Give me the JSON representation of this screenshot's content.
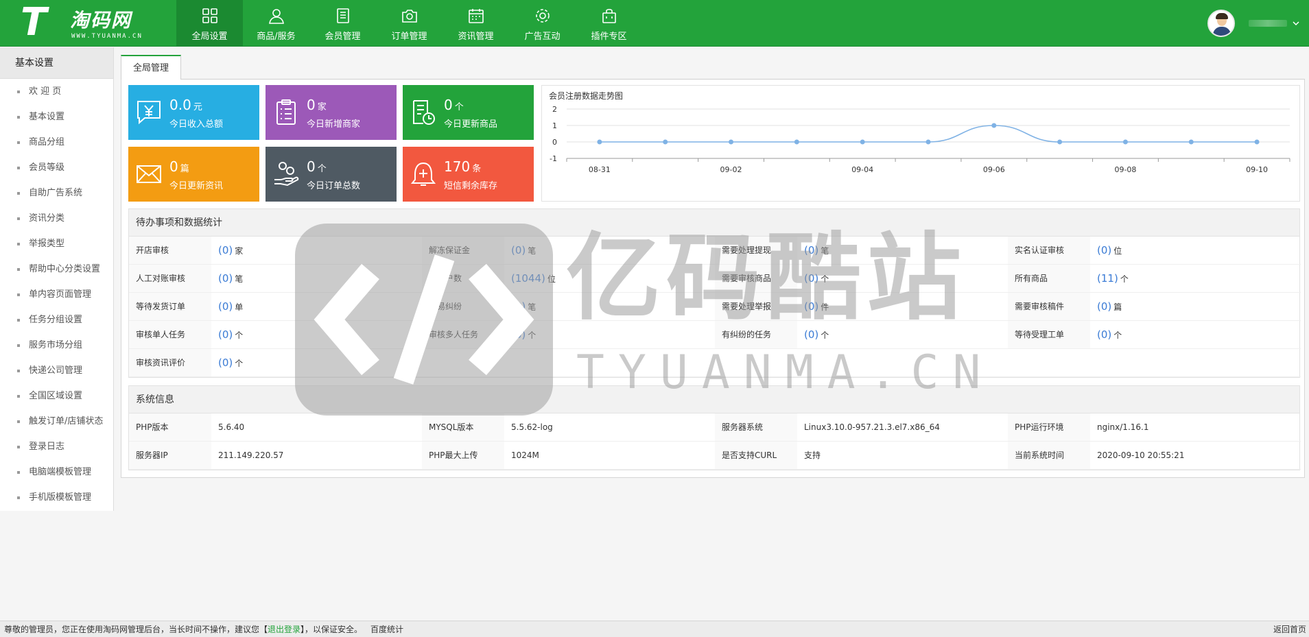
{
  "brand": {
    "name": "淘码网",
    "sub": "WWW.TYUANMA.CN",
    "mark": "T"
  },
  "nav": [
    {
      "label": "全局设置",
      "icon": "grid-icon",
      "active": true
    },
    {
      "label": "商品/服务",
      "icon": "user-icon"
    },
    {
      "label": "会员管理",
      "icon": "document-icon"
    },
    {
      "label": "订单管理",
      "icon": "camera-icon"
    },
    {
      "label": "资讯管理",
      "icon": "calendar-icon"
    },
    {
      "label": "广告互动",
      "icon": "gear-icon"
    },
    {
      "label": "插件专区",
      "icon": "bag-icon"
    }
  ],
  "sidebar": {
    "title": "基本设置",
    "items": [
      "欢 迎 页",
      "基本设置",
      "商品分组",
      "会员等级",
      "自助广告系统",
      "资讯分类",
      "举报类型",
      "帮助中心分类设置",
      "单内容页面管理",
      "任务分组设置",
      "服务市场分组",
      "快递公司管理",
      "全国区域设置",
      "触发订单/店铺状态",
      "登录日志",
      "电脑端模板管理",
      "手机版模板管理"
    ]
  },
  "tab": {
    "label": "全局管理"
  },
  "cards": [
    {
      "value": "0.0",
      "unit": "元",
      "label": "今日收入总额",
      "color": "#27aee2",
      "icon": "money-chat-icon"
    },
    {
      "value": "0",
      "unit": "家",
      "label": "今日新增商家",
      "color": "#9c59b8",
      "icon": "clipboard-icon"
    },
    {
      "value": "0",
      "unit": "个",
      "label": "今日更新商品",
      "color": "#23a33b",
      "icon": "doc-clock-icon"
    },
    {
      "value": "0",
      "unit": "篇",
      "label": "今日更新资讯",
      "color": "#f39c12",
      "icon": "mail-icon"
    },
    {
      "value": "0",
      "unit": "个",
      "label": "今日订单总数",
      "color": "#4f5a63",
      "icon": "hand-coins-icon"
    },
    {
      "value": "170",
      "unit": "条",
      "label": "短信剩余库存",
      "color": "#f2583f",
      "icon": "bell-icon"
    }
  ],
  "chart_data": {
    "type": "line",
    "title": "会员注册数据走势图",
    "x": [
      "08-31",
      "09-01",
      "09-02",
      "09-03",
      "09-04",
      "09-05",
      "09-06",
      "09-07",
      "09-08",
      "09-09",
      "09-10"
    ],
    "xticks": [
      "08-31",
      "09-02",
      "09-04",
      "09-06",
      "09-08",
      "09-10"
    ],
    "values": [
      0,
      0,
      0,
      0,
      0,
      0,
      1,
      0,
      0,
      0,
      0
    ],
    "ylim": [
      -1,
      2
    ],
    "yticks": [
      "2",
      "1",
      "0",
      "-1"
    ],
    "grid": true,
    "color": "#7fb2e5"
  },
  "todo": {
    "title": "待办事项和数据统计",
    "rows": [
      [
        [
          "开店审核",
          "0",
          "家"
        ],
        [
          "解冻保证金",
          "0",
          "笔"
        ],
        [
          "需要处理提现",
          "0",
          "笔"
        ],
        [
          "实名认证审核",
          "0",
          "位"
        ]
      ],
      [
        [
          "人工对账审核",
          "0",
          "笔"
        ],
        [
          "总用户数",
          "1044",
          "位"
        ],
        [
          "需要审核商品",
          "0",
          "个"
        ],
        [
          "所有商品",
          "11",
          "个"
        ]
      ],
      [
        [
          "等待发货订单",
          "0",
          "单"
        ],
        [
          "交易纠纷",
          "0",
          "笔"
        ],
        [
          "需要处理举报",
          "0",
          "件"
        ],
        [
          "需要审核稿件",
          "0",
          "篇"
        ]
      ],
      [
        [
          "审核单人任务",
          "0",
          "个"
        ],
        [
          "审核多人任务",
          "0",
          "个"
        ],
        [
          "有纠纷的任务",
          "0",
          "个"
        ],
        [
          "等待受理工单",
          "0",
          "个"
        ]
      ],
      [
        [
          "审核资讯评价",
          "0",
          "个"
        ]
      ]
    ]
  },
  "sysinfo": {
    "title": "系统信息",
    "rows": [
      [
        [
          "PHP版本",
          "5.6.40"
        ],
        [
          "MYSQL版本",
          "5.5.62-log"
        ],
        [
          "服务器系统",
          "Linux3.10.0-957.21.3.el7.x86_64"
        ],
        [
          "PHP运行环境",
          "nginx/1.16.1"
        ]
      ],
      [
        [
          "服务器IP",
          "211.149.220.57"
        ],
        [
          "PHP最大上传",
          "1024M"
        ],
        [
          "是否支持CURL",
          "支持"
        ],
        [
          "当前系统时间",
          "2020-09-10 20:55:21"
        ]
      ]
    ]
  },
  "watermark": {
    "big": "亿码酷站",
    "small": "TYUANMA.CN"
  },
  "footer": {
    "prefix": "尊敬的管理员，您正在使用淘码网管理后台，当长时间不操作，建议您【",
    "logout": "退出登录",
    "suffix": "】，以保证安全。",
    "stats": "百度统计",
    "home": "返回首页"
  }
}
